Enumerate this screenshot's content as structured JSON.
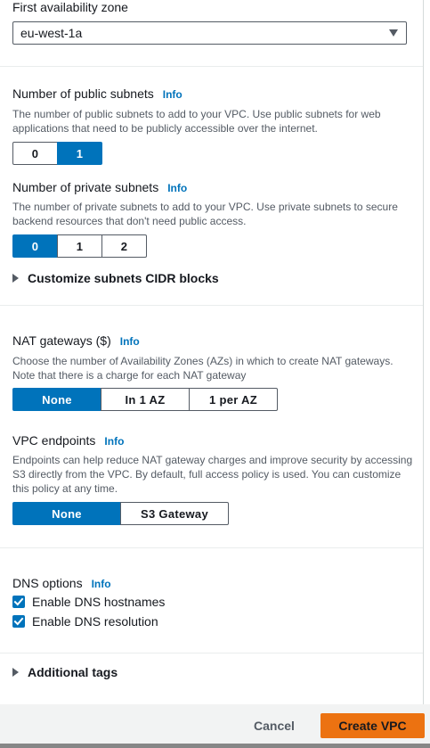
{
  "availability_zone": {
    "label": "First availability zone",
    "selected": "eu-west-1a"
  },
  "public_subnets": {
    "label": "Number of public subnets",
    "info": "Info",
    "description": "The number of public subnets to add to your VPC. Use public subnets for web applications that need to be publicly accessible over the internet.",
    "options": [
      "0",
      "1"
    ],
    "selected": "1"
  },
  "private_subnets": {
    "label": "Number of private subnets",
    "info": "Info",
    "description": "The number of private subnets to add to your VPC. Use private subnets to secure backend resources that don't need public access.",
    "options": [
      "0",
      "1",
      "2"
    ],
    "selected": "0"
  },
  "customize_cidr": {
    "label": "Customize subnets CIDR blocks"
  },
  "nat_gateways": {
    "label": "NAT gateways ($)",
    "info": "Info",
    "description": "Choose the number of Availability Zones (AZs) in which to create NAT gateways. Note that there is a charge for each NAT gateway",
    "options": [
      "None",
      "In 1 AZ",
      "1 per AZ"
    ],
    "selected": "None"
  },
  "vpc_endpoints": {
    "label": "VPC endpoints",
    "info": "Info",
    "description": "Endpoints can help reduce NAT gateway charges and improve security by accessing S3 directly from the VPC. By default, full access policy is used. You can customize this policy at any time.",
    "options": [
      "None",
      "S3 Gateway"
    ],
    "selected": "None"
  },
  "dns_options": {
    "label": "DNS options",
    "info": "Info",
    "hostnames": {
      "label": "Enable DNS hostnames",
      "checked": true
    },
    "resolution": {
      "label": "Enable DNS resolution",
      "checked": true
    }
  },
  "additional_tags": {
    "label": "Additional tags"
  },
  "footer": {
    "cancel": "Cancel",
    "create": "Create VPC"
  },
  "colors": {
    "accent": "#0073bb",
    "primary_button": "#ec7211",
    "text": "#16191f",
    "muted_text": "#545b64"
  },
  "icons": {
    "dropdown": "caret-down-icon",
    "expander": "caret-right-icon",
    "checkbox": "checkmark-icon"
  }
}
